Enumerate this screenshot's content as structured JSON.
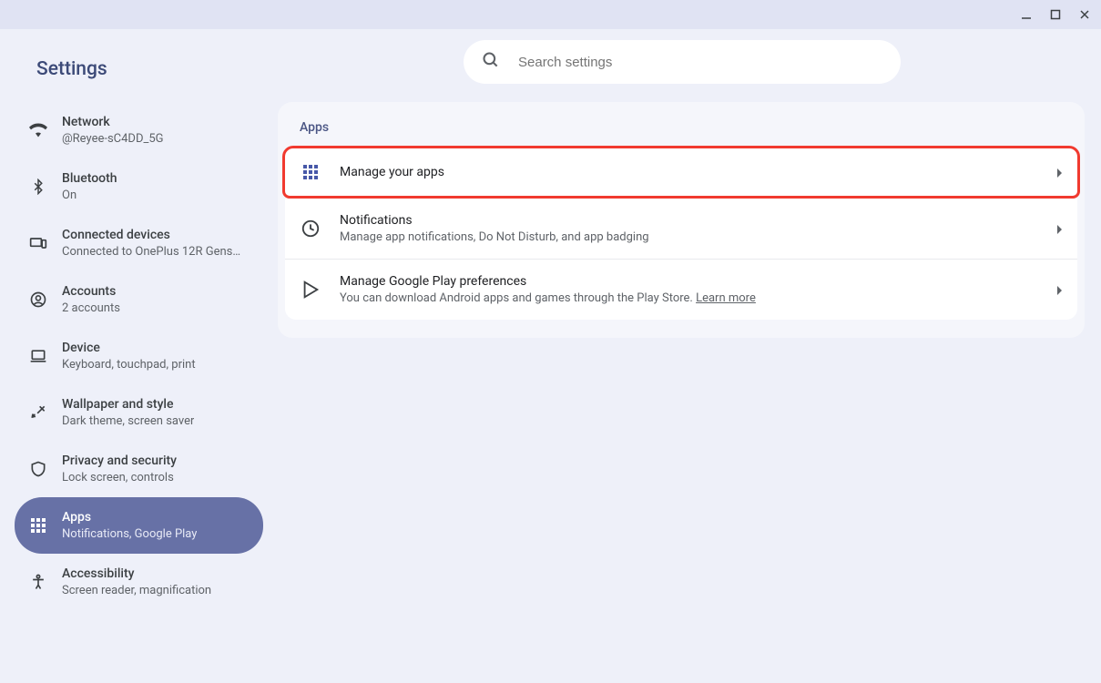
{
  "app_title": "Settings",
  "search": {
    "placeholder": "Search settings"
  },
  "sidebar": {
    "items": [
      {
        "title": "Network",
        "subtitle": "@Reyee-sC4DD_5G"
      },
      {
        "title": "Bluetooth",
        "subtitle": "On"
      },
      {
        "title": "Connected devices",
        "subtitle": "Connected to OnePlus 12R Gens…"
      },
      {
        "title": "Accounts",
        "subtitle": "2 accounts"
      },
      {
        "title": "Device",
        "subtitle": "Keyboard, touchpad, print"
      },
      {
        "title": "Wallpaper and style",
        "subtitle": "Dark theme, screen saver"
      },
      {
        "title": "Privacy and security",
        "subtitle": "Lock screen, controls"
      },
      {
        "title": "Apps",
        "subtitle": "Notifications, Google Play"
      },
      {
        "title": "Accessibility",
        "subtitle": "Screen reader, magnification"
      }
    ]
  },
  "section_title": "Apps",
  "rows": {
    "manage": {
      "title": "Manage your apps"
    },
    "notifications": {
      "title": "Notifications",
      "subtitle": "Manage app notifications, Do Not Disturb, and app badging"
    },
    "play": {
      "title": "Manage Google Play preferences",
      "subtitle_prefix": "You can download Android apps and games through the Play Store. ",
      "learn_more": "Learn more"
    }
  }
}
